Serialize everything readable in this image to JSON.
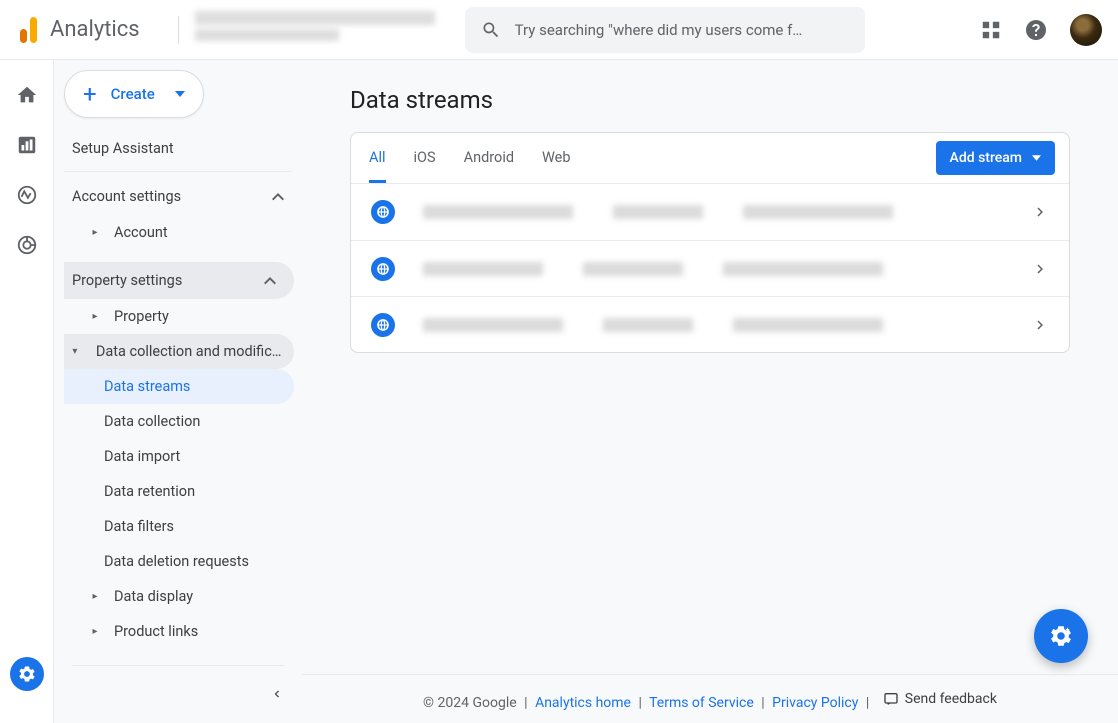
{
  "header": {
    "product": "Analytics",
    "search_placeholder": "Try searching \"where did my users come f…"
  },
  "sidebar": {
    "create_label": "Create",
    "setup_assistant": "Setup Assistant",
    "account_settings_label": "Account settings",
    "account_label": "Account",
    "property_settings_label": "Property settings",
    "property_label": "Property",
    "data_collection_mod_label": "Data collection and modifica…",
    "subitems": {
      "data_streams": "Data streams",
      "data_collection": "Data collection",
      "data_import": "Data import",
      "data_retention": "Data retention",
      "data_filters": "Data filters",
      "data_deletion": "Data deletion requests"
    },
    "data_display_label": "Data display",
    "product_links_label": "Product links"
  },
  "main": {
    "title": "Data streams",
    "tabs": {
      "all": "All",
      "ios": "iOS",
      "android": "Android",
      "web": "Web"
    },
    "add_stream": "Add stream"
  },
  "footer": {
    "copyright": "© 2024 Google",
    "analytics_home": "Analytics home",
    "tos": "Terms of Service",
    "privacy": "Privacy Policy",
    "feedback": "Send feedback"
  }
}
